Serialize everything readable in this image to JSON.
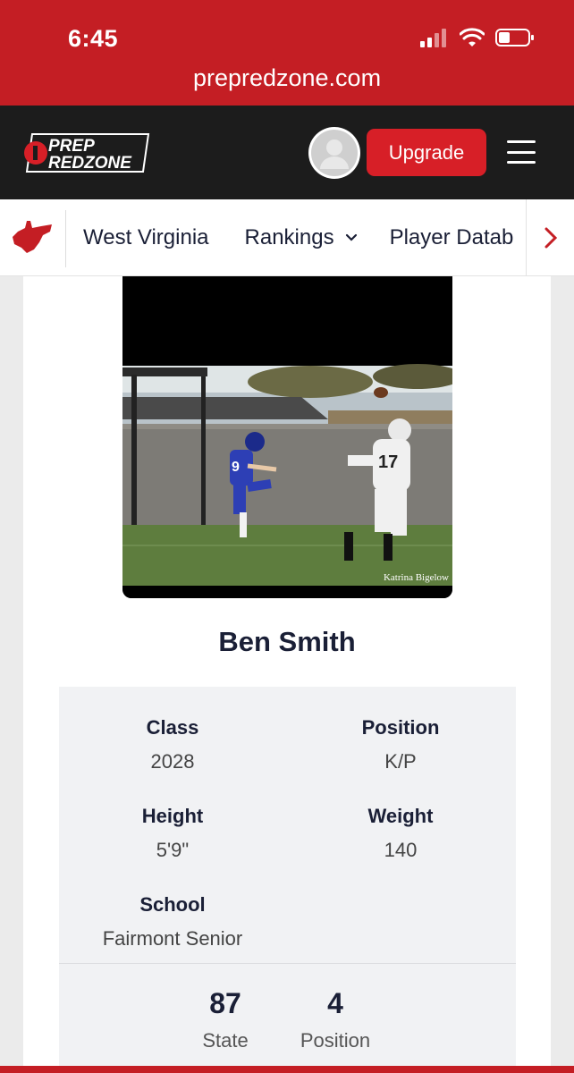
{
  "status_bar": {
    "time": "6:45"
  },
  "browser": {
    "url": "prepredzone.com"
  },
  "header": {
    "logo_top": "PREP",
    "logo_bottom": "REDZONE",
    "upgrade_label": "Upgrade"
  },
  "nav": {
    "items": [
      {
        "label": "West Virginia"
      },
      {
        "label": "Rankings"
      },
      {
        "label": "Player Datab"
      }
    ]
  },
  "photo": {
    "credit": "Katrina Bigelow",
    "jersey_kicker": "9",
    "jersey_defender": "17"
  },
  "player": {
    "name": "Ben Smith",
    "stats": [
      {
        "label": "Class",
        "value": "2028"
      },
      {
        "label": "Position",
        "value": "K/P"
      },
      {
        "label": "Height",
        "value": "5'9\""
      },
      {
        "label": "Weight",
        "value": "140"
      },
      {
        "label": "School",
        "value": "Fairmont Senior"
      }
    ],
    "rankings": [
      {
        "rank": "87",
        "label": "State"
      },
      {
        "rank": "4",
        "label": "Position"
      }
    ]
  },
  "colors": {
    "brand_red": "#c41e24",
    "header_dark": "#1c1c1c",
    "button_red": "#d71f27"
  }
}
